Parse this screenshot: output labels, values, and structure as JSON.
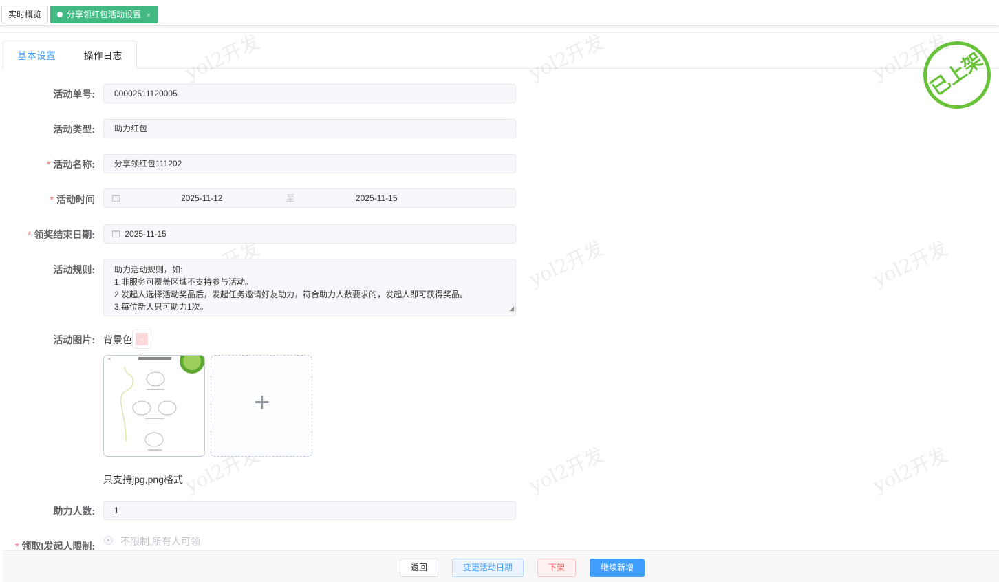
{
  "top_tabs": [
    {
      "label": "实时概览"
    },
    {
      "label": "分享领红包活动设置",
      "close": "×"
    }
  ],
  "tabs": [
    "基本设置",
    "操作日志"
  ],
  "watermark": "yol2开发",
  "stamp": "已上架",
  "form": {
    "order_no": {
      "label": "活动单号:",
      "value": "00002511120005"
    },
    "type": {
      "label": "活动类型:",
      "value": "助力红包"
    },
    "name": {
      "label": "活动名称:",
      "value": "分享领红包111202"
    },
    "time": {
      "label": "活动时间",
      "start": "2025-11-12",
      "sep": "至",
      "end": "2025-11-15"
    },
    "claim_end": {
      "label": "领奖结束日期:",
      "value": "2025-11-15"
    },
    "rules": {
      "label": "活动规则:",
      "lines": [
        "助力活动规则，如:",
        "1.非服务可覆盖区域不支持参与活动。",
        "2.发起人选择活动奖品后，发起任务邀请好友助力，符合助力人数要求的，发起人即可获得奖品。",
        "3.每位新人只可助力1次。"
      ]
    },
    "image": {
      "label": "活动图片:",
      "bg_label": "背景色",
      "bg_color": "#fbd9da",
      "hint": "只支持jpg,png格式"
    },
    "helpers": {
      "label": "助力人数:",
      "value": "1"
    },
    "limit": {
      "label": "领取I发起人限制:",
      "option": "不限制,所有人可领"
    }
  },
  "footer": {
    "back": "返回",
    "change_date": "变更活动日期",
    "offline": "下架",
    "continue": "继续新增"
  }
}
